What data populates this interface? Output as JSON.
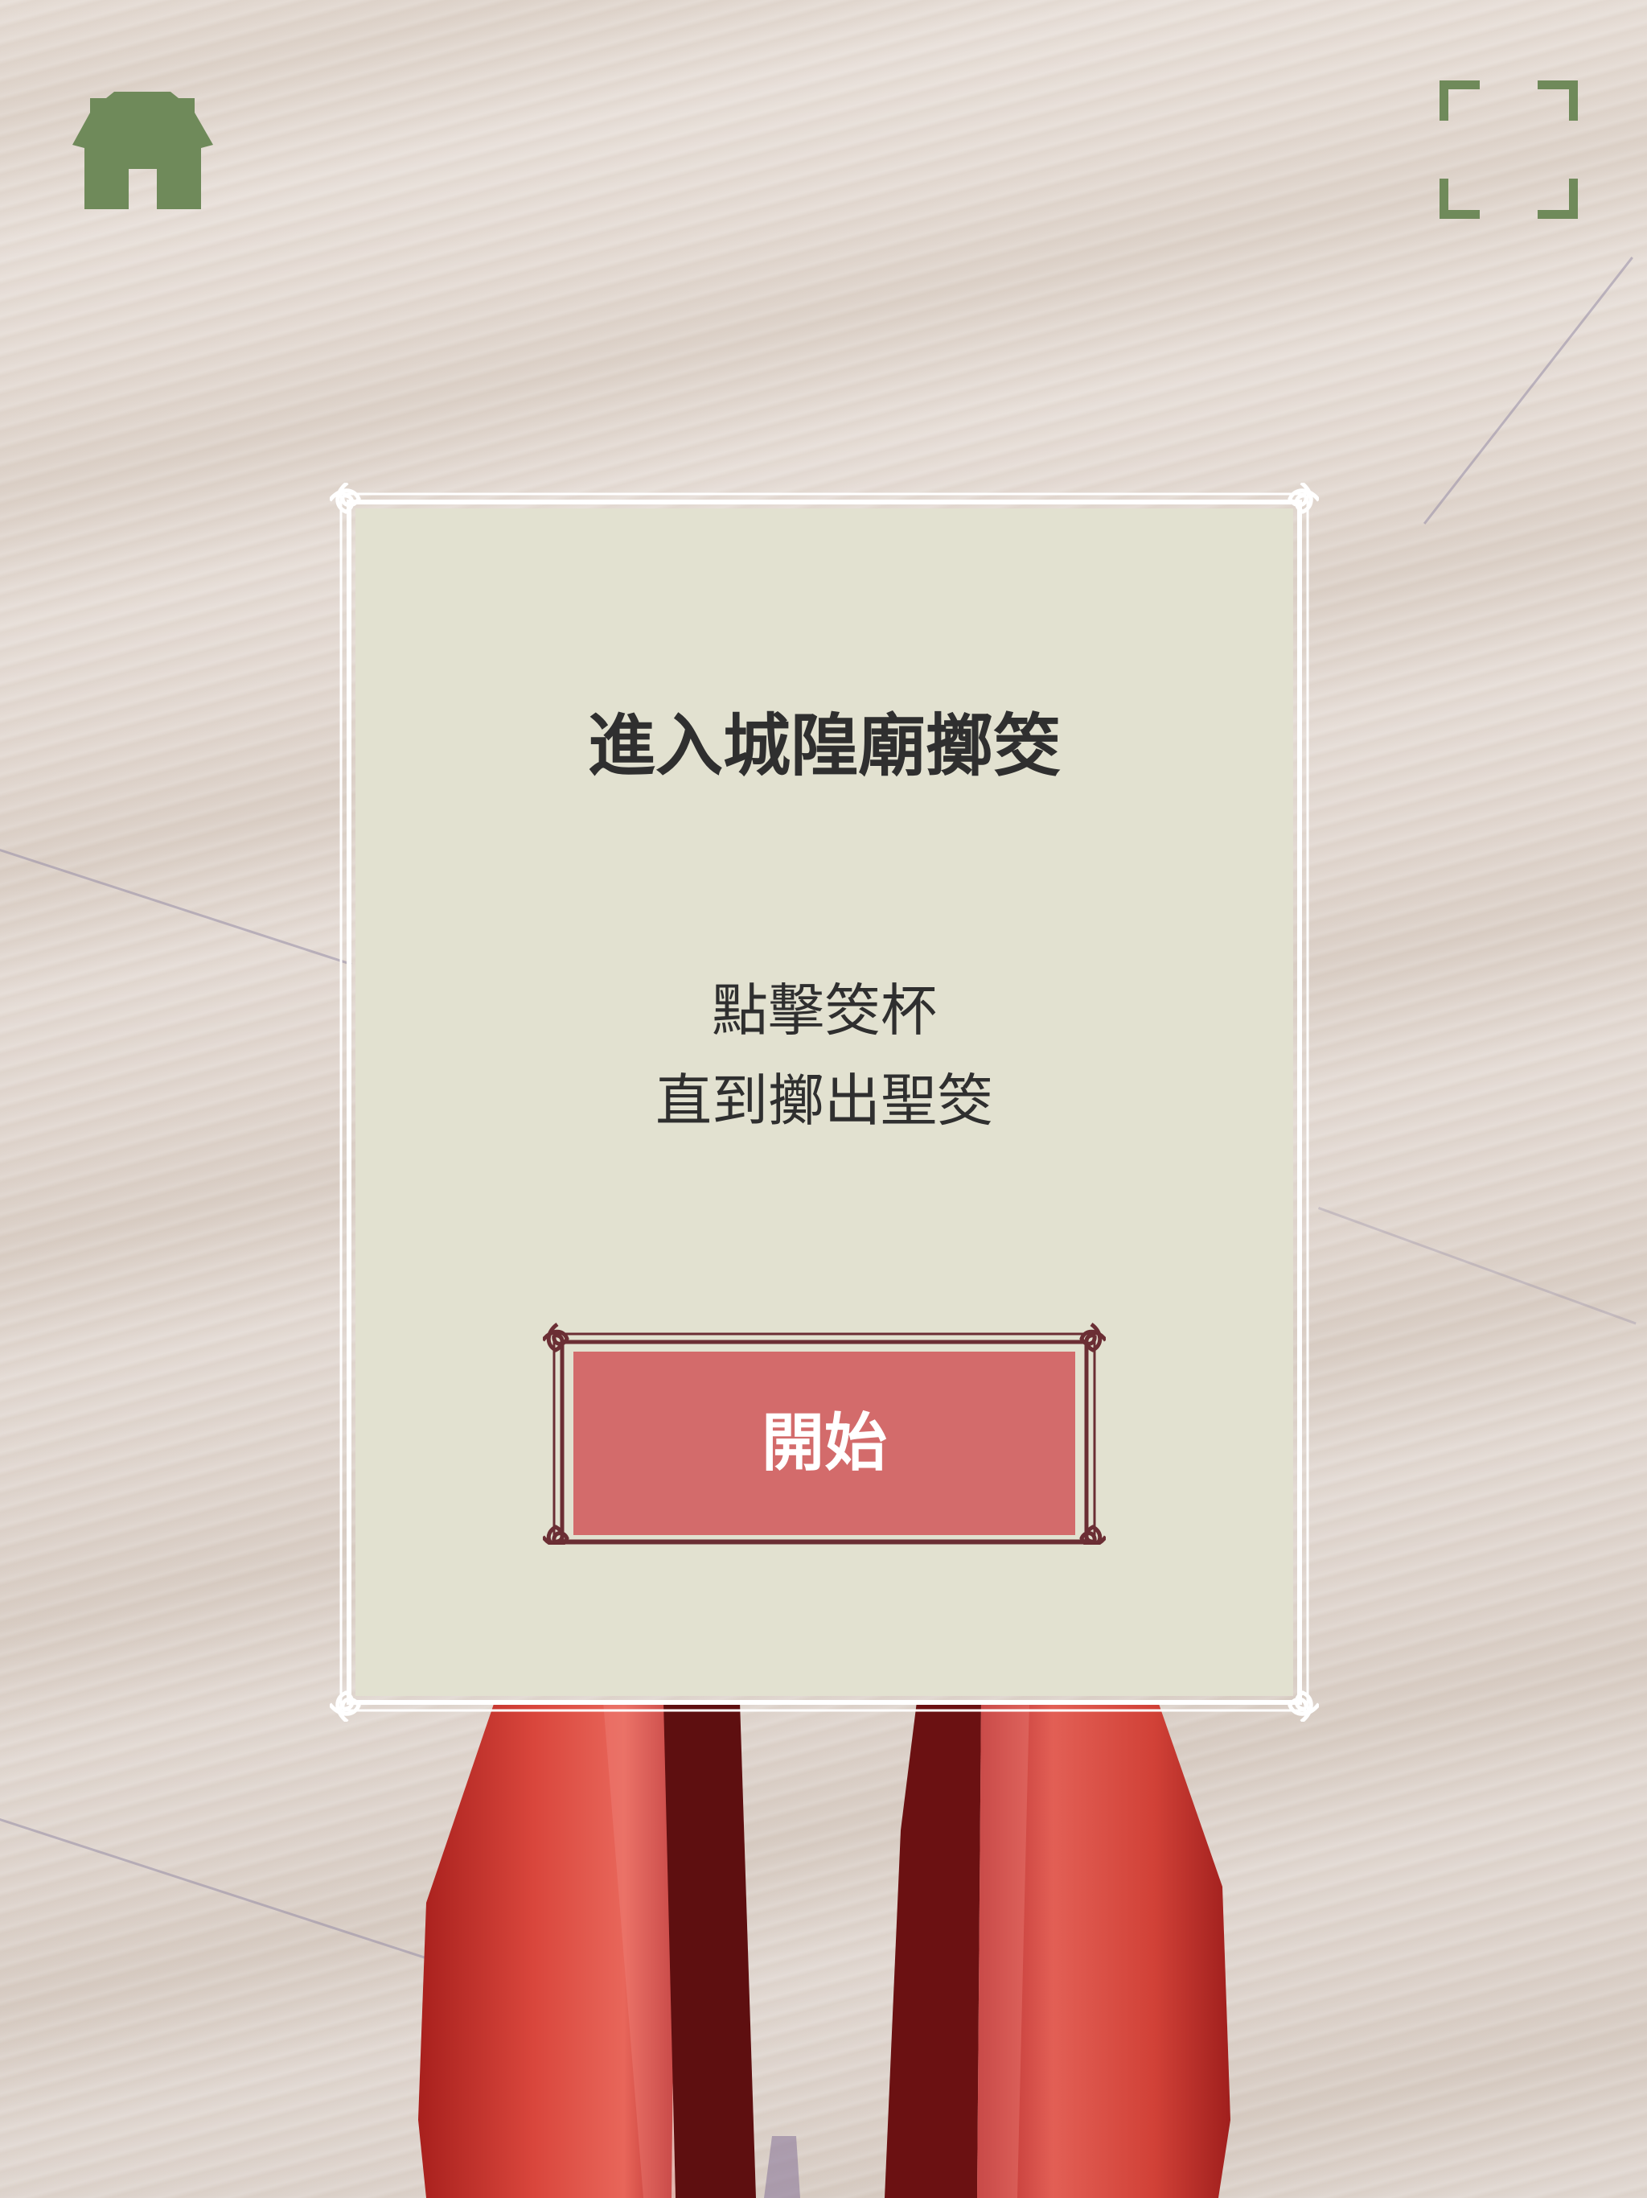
{
  "toolbar": {
    "home_icon": "home-icon",
    "fullscreen_icon": "fullscreen-icon",
    "icon_color": "#6f8a5a"
  },
  "dialog": {
    "title": "進入城隍廟擲筊",
    "instruction_line1": "點擊筊杯",
    "instruction_line2": "直到擲出聖筊",
    "start_label": "開始",
    "panel_color": "#e2e1d0",
    "button_color": "#d36b6b",
    "button_frame_color": "#6b2e34"
  },
  "scene": {
    "object": "moon-blocks",
    "object_color": "#c8332e"
  }
}
